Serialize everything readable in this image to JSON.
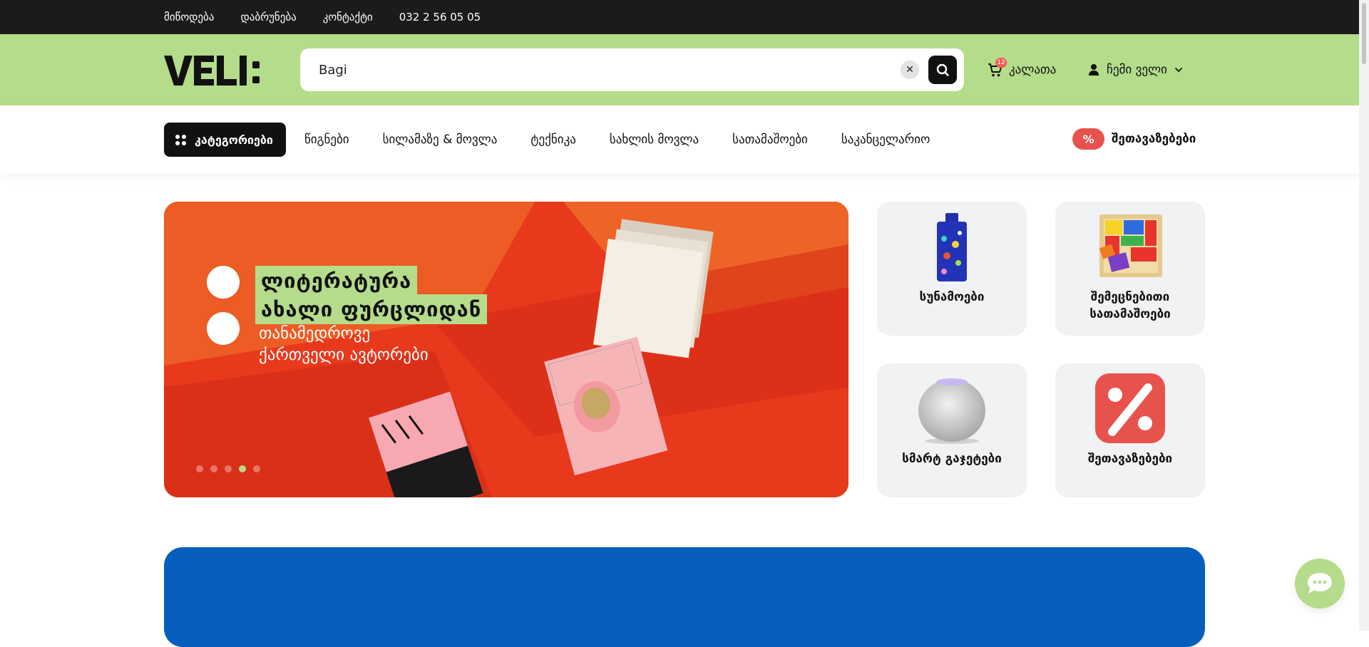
{
  "topbar": {
    "links": [
      "მიწოდება",
      "დაბრუნება",
      "კონტაქტი",
      "032 2 56 05 05"
    ]
  },
  "header": {
    "logo_text": "VELI:",
    "search": {
      "value": "Bagi",
      "placeholder": ""
    },
    "cart": {
      "label": "კალათა",
      "count": "12"
    },
    "account": {
      "label": "ჩემი ველი"
    }
  },
  "nav": {
    "categories_button": "კატეგორიები",
    "links": [
      "წიგნები",
      "სილამაზე & მოვლა",
      "ტექნიკა",
      "სახლის მოვლა",
      "სათამაშოები",
      "საკანცელარიო"
    ],
    "deals": {
      "badge": "%",
      "label": "შეთავაზებები"
    }
  },
  "banner": {
    "headline_line1": "ლიტერატურა",
    "headline_line2": "ახალი ფურცლიდან",
    "sub_line1": "თანამედროვე",
    "sub_line2": "ქართველი ავტორები",
    "slides_total": 5,
    "active_slide": 4
  },
  "tiles": [
    {
      "label": "სუნამოები",
      "icon": "perfume-icon"
    },
    {
      "label": "შემეცნებითი სათამაშოები",
      "icon": "puzzle-toy-icon"
    },
    {
      "label": "სმარტ გაჯეტები",
      "icon": "smart-speaker-icon"
    },
    {
      "label": "შეთავაზებები",
      "icon": "percent-icon"
    }
  ],
  "colors": {
    "accent_green": "#b4dc8b",
    "topbar": "#1b1b1b",
    "deal_red": "#e8524d",
    "banner_red": "#e8391d",
    "promo_blue": "#065ebc"
  }
}
